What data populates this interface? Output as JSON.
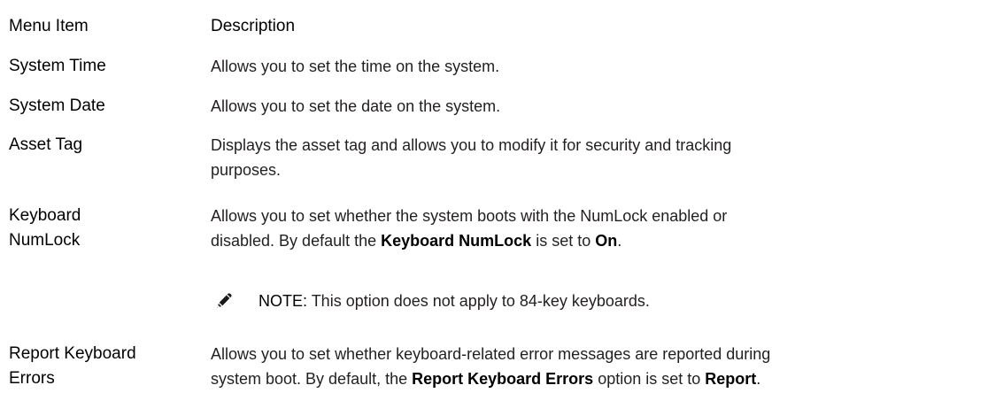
{
  "table": {
    "header": {
      "item": "Menu Item",
      "description": "Description"
    },
    "rows": [
      {
        "item": "System Time",
        "description": "Allows you to set the time on the system."
      },
      {
        "item": "System Date",
        "description": "Allows you to set the date on the system."
      },
      {
        "item": "Asset Tag",
        "description_line1": "Displays the asset tag and allows you to modify it for security and tracking",
        "description_line2": "purposes."
      },
      {
        "item_line1": "Keyboard",
        "item_line2": "NumLock",
        "description_line1": "Allows you to set whether the system boots with the NumLock enabled or",
        "description_line2_a": "disabled. By default the ",
        "description_line2_b": "Keyboard NumLock",
        "description_line2_c": " is set to ",
        "description_line2_d": "On",
        "description_line2_e": ".",
        "note": {
          "label": "NOTE:",
          "text": " This option does not apply to 84-key keyboards.",
          "icon": "note-pencil-icon"
        }
      },
      {
        "item_line1": "Report Keyboard",
        "item_line2": "Errors",
        "description_line1": "Allows you to set whether keyboard-related error messages are reported during",
        "description_line2_a": "system boot. By default, the ",
        "description_line2_b": "Report Keyboard Errors",
        "description_line2_c": " option is set to ",
        "description_line2_d": "Report",
        "description_line2_e": "."
      }
    ]
  }
}
